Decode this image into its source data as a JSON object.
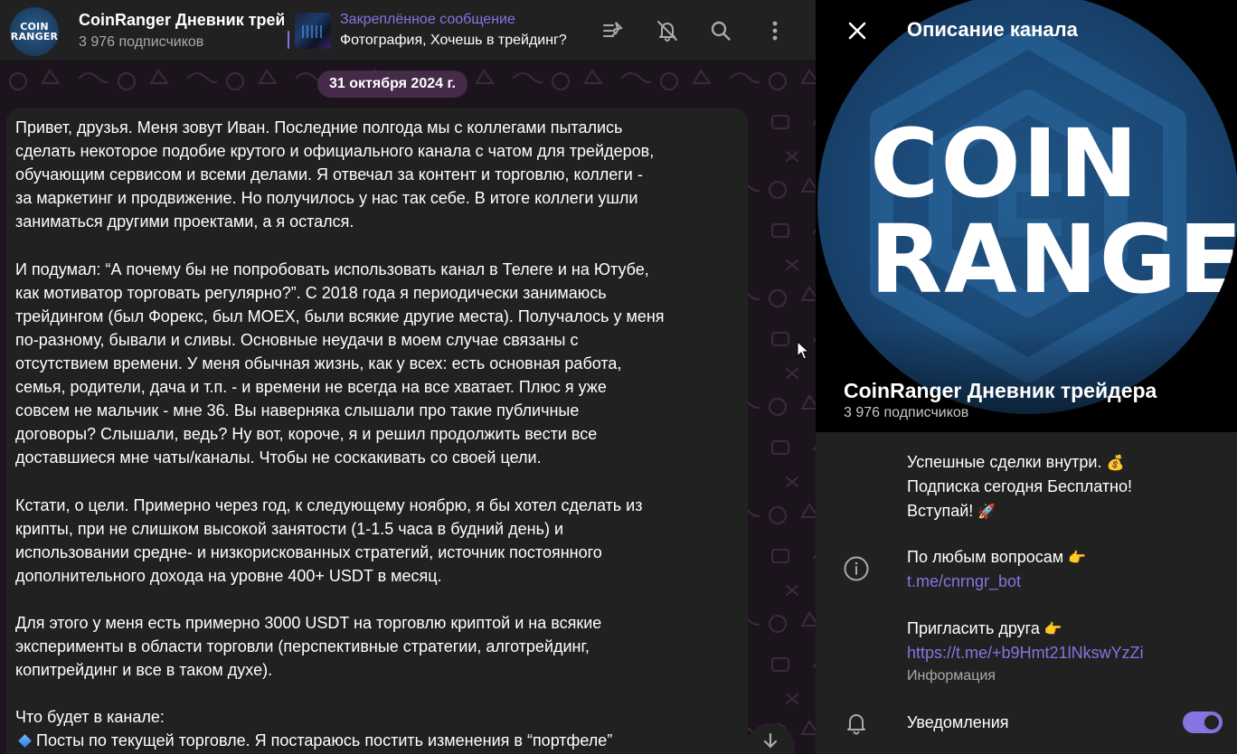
{
  "colors": {
    "accent": "#8774e1",
    "panel_bg": "#212121",
    "chat_bg": "#181218",
    "date_chip": "#4a2d4d",
    "muted_text": "#aaaaaa"
  },
  "header": {
    "avatar_line1": "COIN",
    "avatar_line2": "RANGER",
    "title": "CoinRanger Дневник трейдера",
    "subscribers": "3 976 подписчиков",
    "pinned_label": "Закреплённое сообщение",
    "pinned_text": "Фотография, Хочешь в трейдинг?",
    "icons": [
      "pinned-list-icon",
      "bell-off-icon",
      "search-icon",
      "more-vertical-icon"
    ]
  },
  "chat": {
    "date": "31 октября 2024 г.",
    "message": {
      "paragraphs": [
        "Привет, друзья. Меня зовут Иван. Последние полгода мы с коллегами пытались\nсделать некоторое подобие крутого и официального канала с чатом для трейдеров,\nобучающим сервисом и всеми делами. Я отвечал за контент и торговлю, коллеги -\nза маркетинг и продвижение. Но получилось у нас так себе. В итоге коллеги ушли\nзаниматься другими проектами, а я остался.",
        "И подумал: “А почему бы не попробовать использовать канал в Телеге и на Ютубе,\nкак мотиватор торговать регулярно?”. С 2018 года я периодически занимаюсь\nтрейдингом (был Форекс, был MOEX, были всякие другие места). Получалось у меня\nпо-разному, бывали и сливы. Основные неудачи в моем случае связаны с\nотсутствием времени. У меня обычная жизнь, как у всех: есть основная работа,\nсемья, родители, дача и т.п. - и времени не всегда на все хватает. Плюс я уже\nсовсем не мальчик - мне 36. Вы наверняка слышали про такие публичные\nдоговоры? Слышали, ведь? Ну вот, короче, я и решил продолжить вести все\nдоставшиеся мне чаты/каналы. Чтобы не соскакивать со своей цели.",
        "Кстати, о цели. Примерно через год, к следующему ноябрю, я бы хотел сделать из\nкрипты, при не слишком высокой занятости (1-1.5 часа в будний день) и\nиспользовании средне- и низкорискованных стратегий, источник постоянного\nдополнительного дохода на уровне 400+ USDT в месяц.",
        "Для этого у меня есть примерно 3000 USDT на торговлю криптой и на всякие\nэксперименты в области торговли (перспективные стратегии, алготрейдинг,\nкопитрейдинг и все в таком духе).",
        "Что будет в канале:"
      ],
      "bullet_1": "Посты по текущей торговле. Я постараюсь постить изменения в “портфеле”"
    }
  },
  "panel": {
    "title": "Описание канала",
    "cover_line1": "COIN",
    "cover_line2": "RANGER",
    "name": "CoinRanger Дневник трейдера",
    "subscribers": "3 976 подписчиков",
    "description_line1": "Успешные сделки внутри.",
    "description_emoji1": "💰",
    "description_line2": "Подписка сегодня Бесплатно!",
    "description_line3": "Вступай!",
    "description_emoji3": "🚀",
    "question_text": "По любым вопросам",
    "question_emoji": "👉",
    "bot_link": "t.me/cnrngr_bot",
    "invite_text": "Пригласить друга",
    "invite_emoji": "👉",
    "invite_link": "https://t.me/+b9Hmt21lNkswYzZi",
    "info_label": "Информация",
    "notifications_label": "Уведомления",
    "notifications_on": true
  }
}
